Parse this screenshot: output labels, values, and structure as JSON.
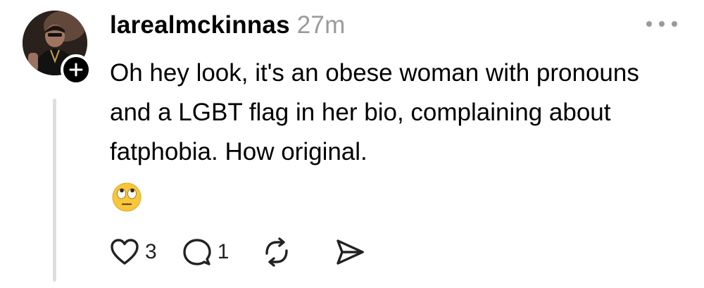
{
  "post": {
    "author": {
      "username": "larealmckinnas",
      "avatar_icon": "profile-photo",
      "follow_icon": "plus-icon"
    },
    "timestamp": "27m",
    "text": "Oh hey look, it's an obese woman with pronouns and a LGBT flag in her bio, complaining about fatphobia. How original.",
    "emoji": "🙄",
    "emoji_name": "face-with-rolling-eyes",
    "menu_icon": "more-horizontal-icon"
  },
  "actions": {
    "like": {
      "icon": "heart-icon",
      "count": "3"
    },
    "reply": {
      "icon": "comment-icon",
      "count": "1"
    },
    "repost": {
      "icon": "repost-icon"
    },
    "share": {
      "icon": "send-icon"
    }
  },
  "colors": {
    "text": "#000000",
    "muted": "#9a9a9a",
    "thread_line": "#dedede",
    "icon": "#222222"
  }
}
